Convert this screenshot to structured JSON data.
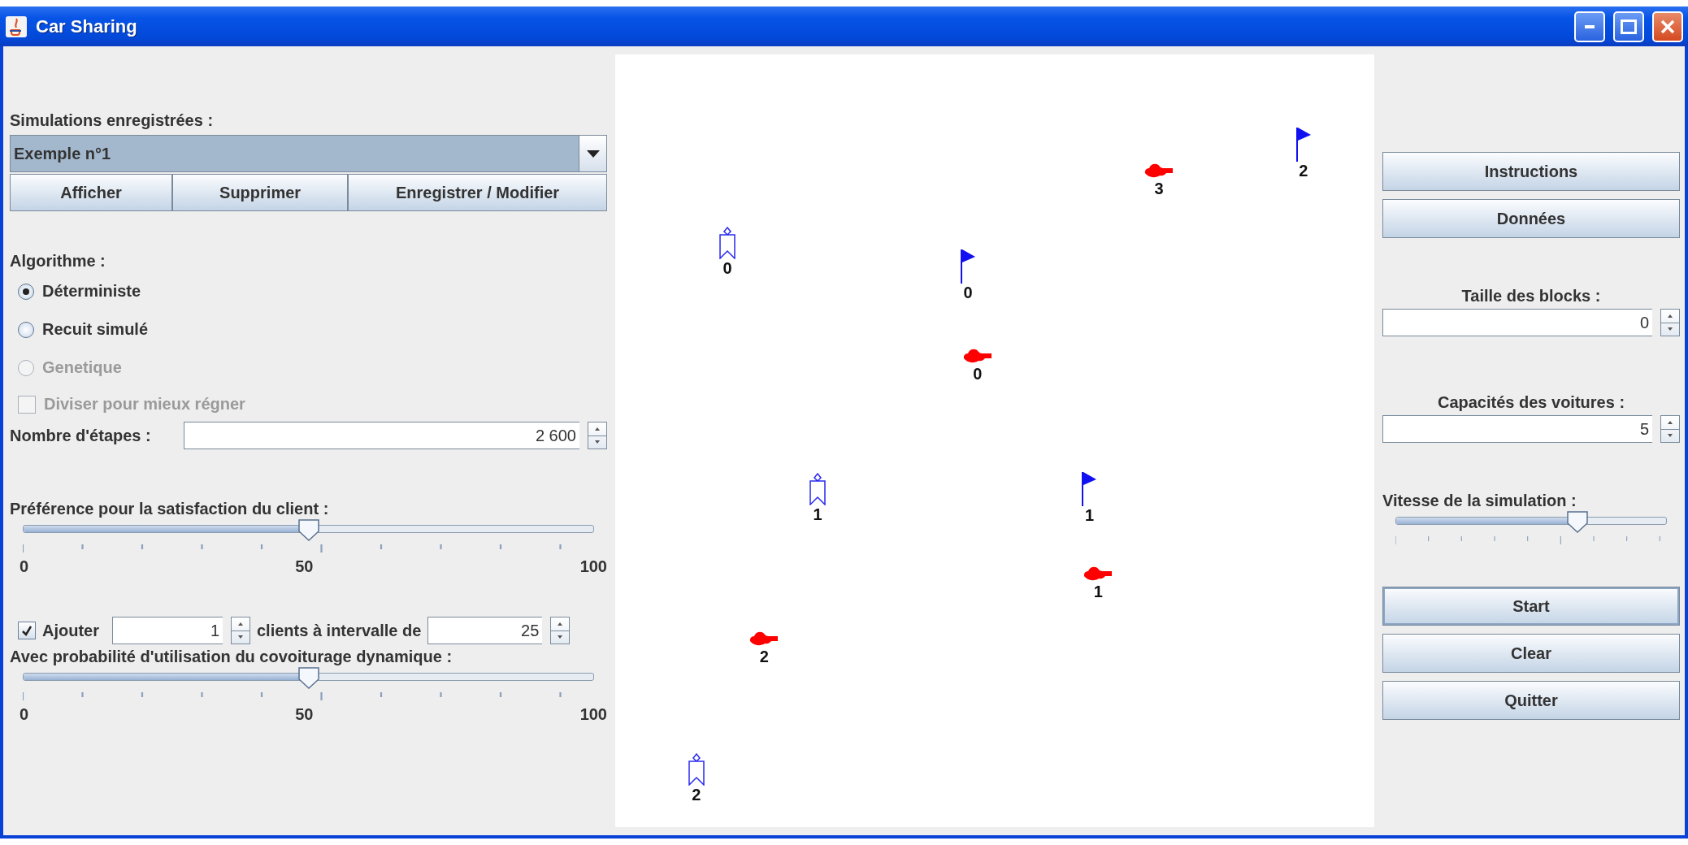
{
  "window": {
    "title": "Car Sharing"
  },
  "saved_simulations": {
    "label": "Simulations enregistrées :",
    "value": "Exemple n°1",
    "buttons": [
      "Afficher",
      "Supprimer",
      "Enregistrer / Modifier"
    ]
  },
  "algorithm": {
    "label": "Algorithme :",
    "options": [
      {
        "label": "Déterministe",
        "selected": true,
        "disabled": false
      },
      {
        "label": "Recuit simulé",
        "selected": false,
        "disabled": false
      },
      {
        "label": "Genetique",
        "selected": false,
        "disabled": true
      }
    ]
  },
  "divide_option": {
    "label": "Diviser pour mieux régner",
    "checked": false,
    "disabled": true
  },
  "steps": {
    "label": "Nombre d'étapes :",
    "value": "2 600"
  },
  "satisfaction": {
    "label": "Préférence pour la satisfaction du client :",
    "level": 0.5,
    "tick_labels": [
      "0",
      "50",
      "100"
    ]
  },
  "add_clients": {
    "checked": true,
    "label": "Ajouter",
    "count": "1",
    "middle_label": "clients à intervalle de",
    "interval": "25"
  },
  "dynamic_probability": {
    "label": "Avec probabilité d'utilisation du covoiturage dynamique :",
    "level": 0.5,
    "tick_labels": [
      "0",
      "50",
      "100"
    ]
  },
  "map": {
    "markers": [
      {
        "kind": "destination",
        "label": "2"
      },
      {
        "kind": "car",
        "label": "3"
      },
      {
        "kind": "client",
        "label": "0"
      },
      {
        "kind": "destination",
        "label": "0"
      },
      {
        "kind": "car",
        "label": "0"
      },
      {
        "kind": "client",
        "label": "1"
      },
      {
        "kind": "destination",
        "label": "1"
      },
      {
        "kind": "car",
        "label": "1"
      },
      {
        "kind": "car",
        "label": "2"
      },
      {
        "kind": "client",
        "label": "2"
      }
    ]
  },
  "side_buttons": [
    "Instructions",
    "Données"
  ],
  "block_size": {
    "label": "Taille des blocks :",
    "value": "0"
  },
  "car_capacity": {
    "label": "Capacités des voitures :",
    "value": "5"
  },
  "speed": {
    "label": "Vitesse de la simulation :",
    "level": 0.67
  },
  "actions": [
    "Start",
    "Clear",
    "Quitter"
  ]
}
